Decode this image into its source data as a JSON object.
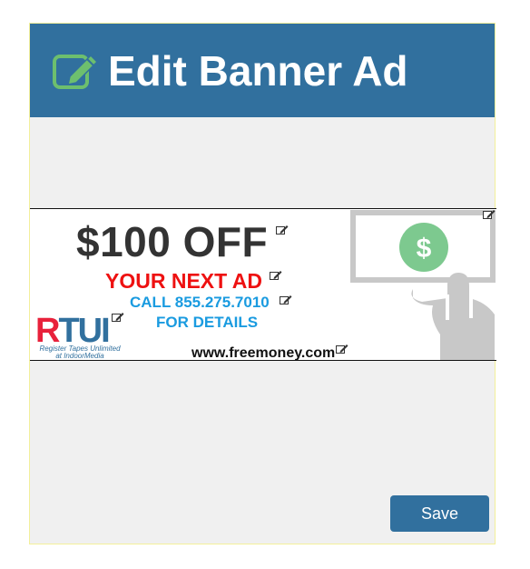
{
  "dialog": {
    "title": "Edit Banner Ad",
    "title_icon": "edit-icon",
    "save_label": "Save"
  },
  "banner": {
    "headline": "$100 OFF",
    "subline": "YOUR NEXT AD",
    "call": "CALL 855.275.7010",
    "details": "FOR DETAILS",
    "url": "www.freemoney.com",
    "logo": {
      "text_r": "R",
      "text_rest": "TUI",
      "sub1": "Register Tapes Unlimited",
      "sub2": "at IndoorMedia"
    },
    "cash_symbol": "$"
  },
  "colors": {
    "header": "#31709e",
    "headline": "#333333",
    "subline": "#ee1111",
    "call": "#1a9be0",
    "coin": "#7dc98f",
    "button": "#31709e"
  }
}
